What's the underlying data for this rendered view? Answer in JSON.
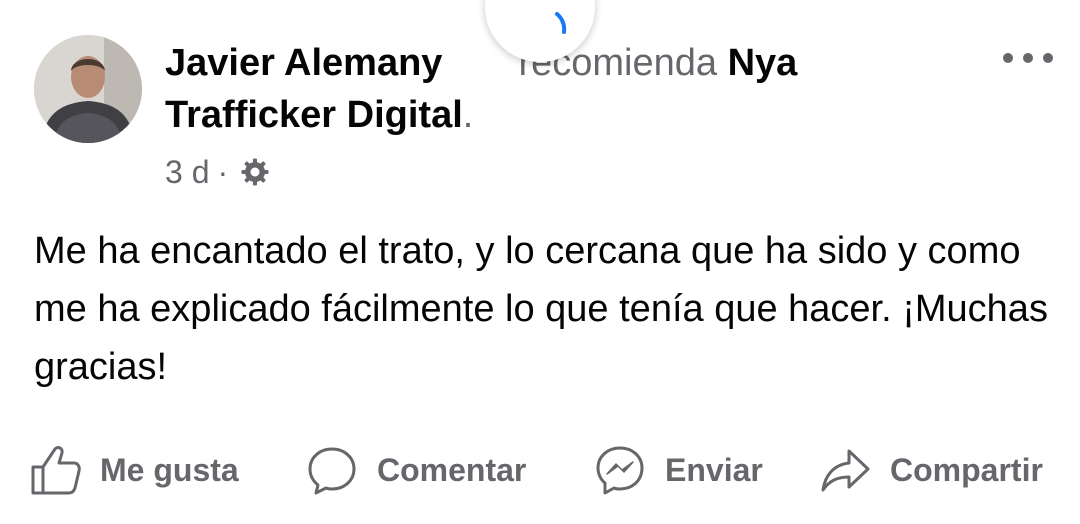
{
  "post": {
    "author": "Javier Alemany",
    "action_text": "recomienda",
    "page_name_part1": "Nya",
    "page_name_part2": "Trafficker Digital",
    "period": ".",
    "time": "3 d",
    "separator": "·",
    "privacy_icon": "gear-icon",
    "text": "Me ha encantado el trato, y lo cercana que ha sido y como me ha explicado fácilmente lo que tenía que hacer. ¡Muchas gracias!"
  },
  "actions": {
    "like": "Me gusta",
    "comment": "Comentar",
    "send": "Enviar",
    "share": "Compartir"
  },
  "colors": {
    "text": "#050505",
    "muted": "#65676b",
    "loader_accent": "#1877f2"
  }
}
